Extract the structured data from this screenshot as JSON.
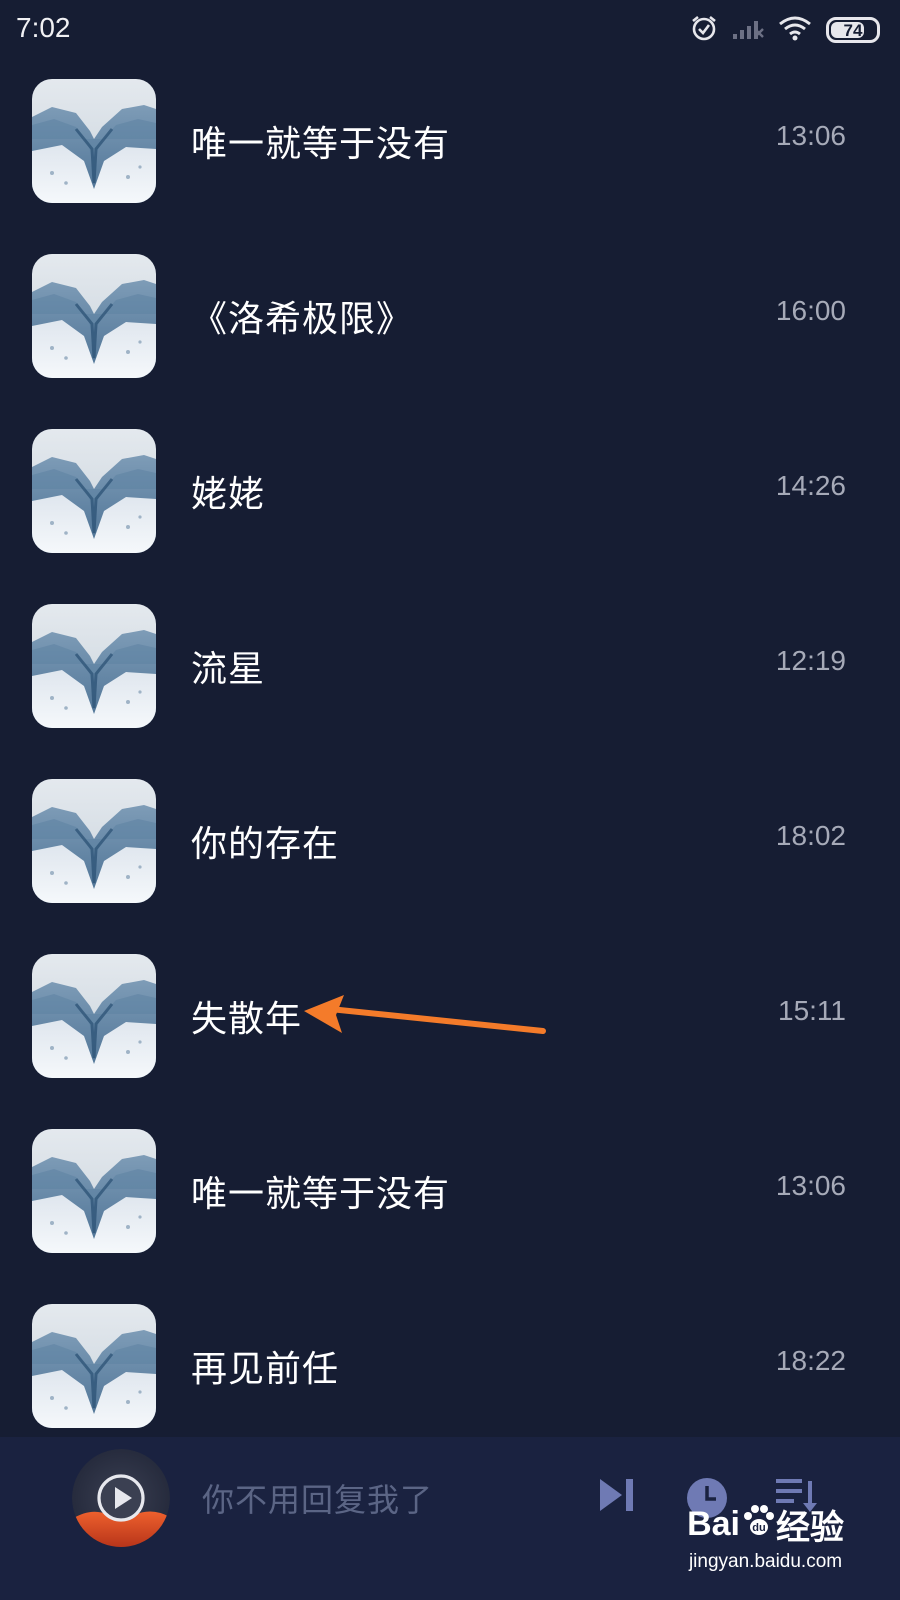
{
  "status_bar": {
    "time": "7:02",
    "battery": "74",
    "battery_fraction": 0.74,
    "icons": [
      "alarm-clock-icon",
      "signal-off-icon",
      "wifi-icon",
      "battery-icon"
    ]
  },
  "songs": [
    {
      "title": "唯一就等于没有",
      "duration": "13:06"
    },
    {
      "title": "《洛希极限》",
      "duration": "16:00"
    },
    {
      "title": "姥姥",
      "duration": "14:26"
    },
    {
      "title": "流星",
      "duration": "12:19"
    },
    {
      "title": "你的存在",
      "duration": "18:02"
    },
    {
      "title": "失散年",
      "duration": "15:11"
    },
    {
      "title": "唯一就等于没有",
      "duration": "13:06"
    },
    {
      "title": "再见前任",
      "duration": "18:22"
    }
  ],
  "player": {
    "now_playing": "你不用回复我了",
    "controls": [
      "play-icon",
      "next-track-icon",
      "timer-icon",
      "playlist-icon"
    ]
  },
  "watermark": {
    "brand_left": "Bai",
    "brand_right": "经验",
    "url": "jingyan.baidu.com"
  },
  "annotation": {
    "arrow_color": "#f47b2a"
  },
  "colors": {
    "background": "#161d33",
    "player_bar": "#1a2240",
    "duration_text": "#a6aab8",
    "player_text": "#5b6585",
    "control_icons": "#6f7ab4"
  }
}
